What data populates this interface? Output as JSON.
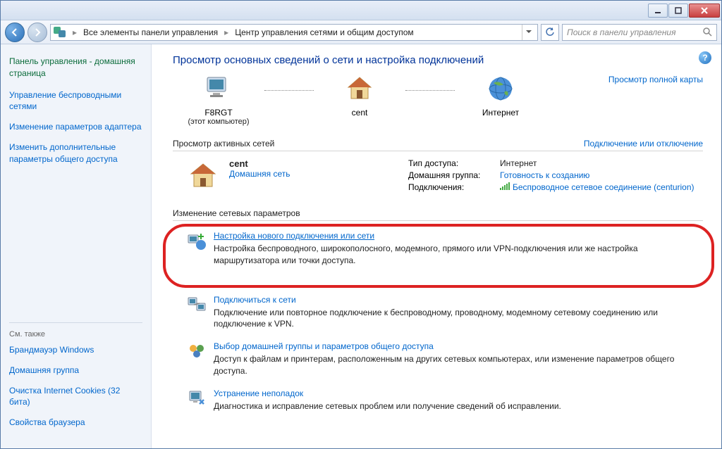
{
  "titlebar_app": "",
  "nav": {
    "crumb1": "Все элементы панели управления",
    "crumb2": "Центр управления сетями и общим доступом",
    "search_placeholder": "Поиск в панели управления"
  },
  "sidebar": {
    "home": "Панель управления - домашняя страница",
    "links": [
      "Управление беспроводными сетями",
      "Изменение параметров адаптера",
      "Изменить дополнительные параметры общего доступа"
    ],
    "see_also_hdr": "См. также",
    "see_also": [
      "Брандмауэр Windows",
      "Домашняя группа",
      "Очистка Internet Cookies (32 бита)",
      "Свойства браузера"
    ]
  },
  "main": {
    "title": "Просмотр основных сведений о сети и настройка подключений",
    "map": {
      "node1_label": "F8RGT",
      "node1_sub": "(этот компьютер)",
      "node2_label": "cent",
      "node3_label": "Интернет",
      "full_map_link": "Просмотр полной карты"
    },
    "active_header": "Просмотр активных сетей",
    "active_link": "Подключение или отключение",
    "network": {
      "name": "cent",
      "type": "Домашняя сеть",
      "rows": {
        "access_k": "Тип доступа:",
        "access_v": "Интернет",
        "homegroup_k": "Домашняя группа:",
        "homegroup_v": "Готовность к созданию",
        "conn_k": "Подключения:",
        "conn_v": "Беспроводное сетевое соединение (centurion)"
      }
    },
    "change_header": "Изменение сетевых параметров",
    "tasks": [
      {
        "title": "Настройка нового подключения или сети",
        "desc": "Настройка беспроводного, широкополосного, модемного, прямого или VPN-подключения или же настройка маршрутизатора или точки доступа."
      },
      {
        "title": "Подключиться к сети",
        "desc": "Подключение или повторное подключение к беспроводному, проводному, модемному сетевому соединению или подключение к VPN."
      },
      {
        "title": "Выбор домашней группы и параметров общего доступа",
        "desc": "Доступ к файлам и принтерам, расположенным на других сетевых компьютерах, или изменение параметров общего доступа."
      },
      {
        "title": "Устранение неполадок",
        "desc": "Диагностика и исправление сетевых проблем или получение сведений об исправлении."
      }
    ]
  }
}
